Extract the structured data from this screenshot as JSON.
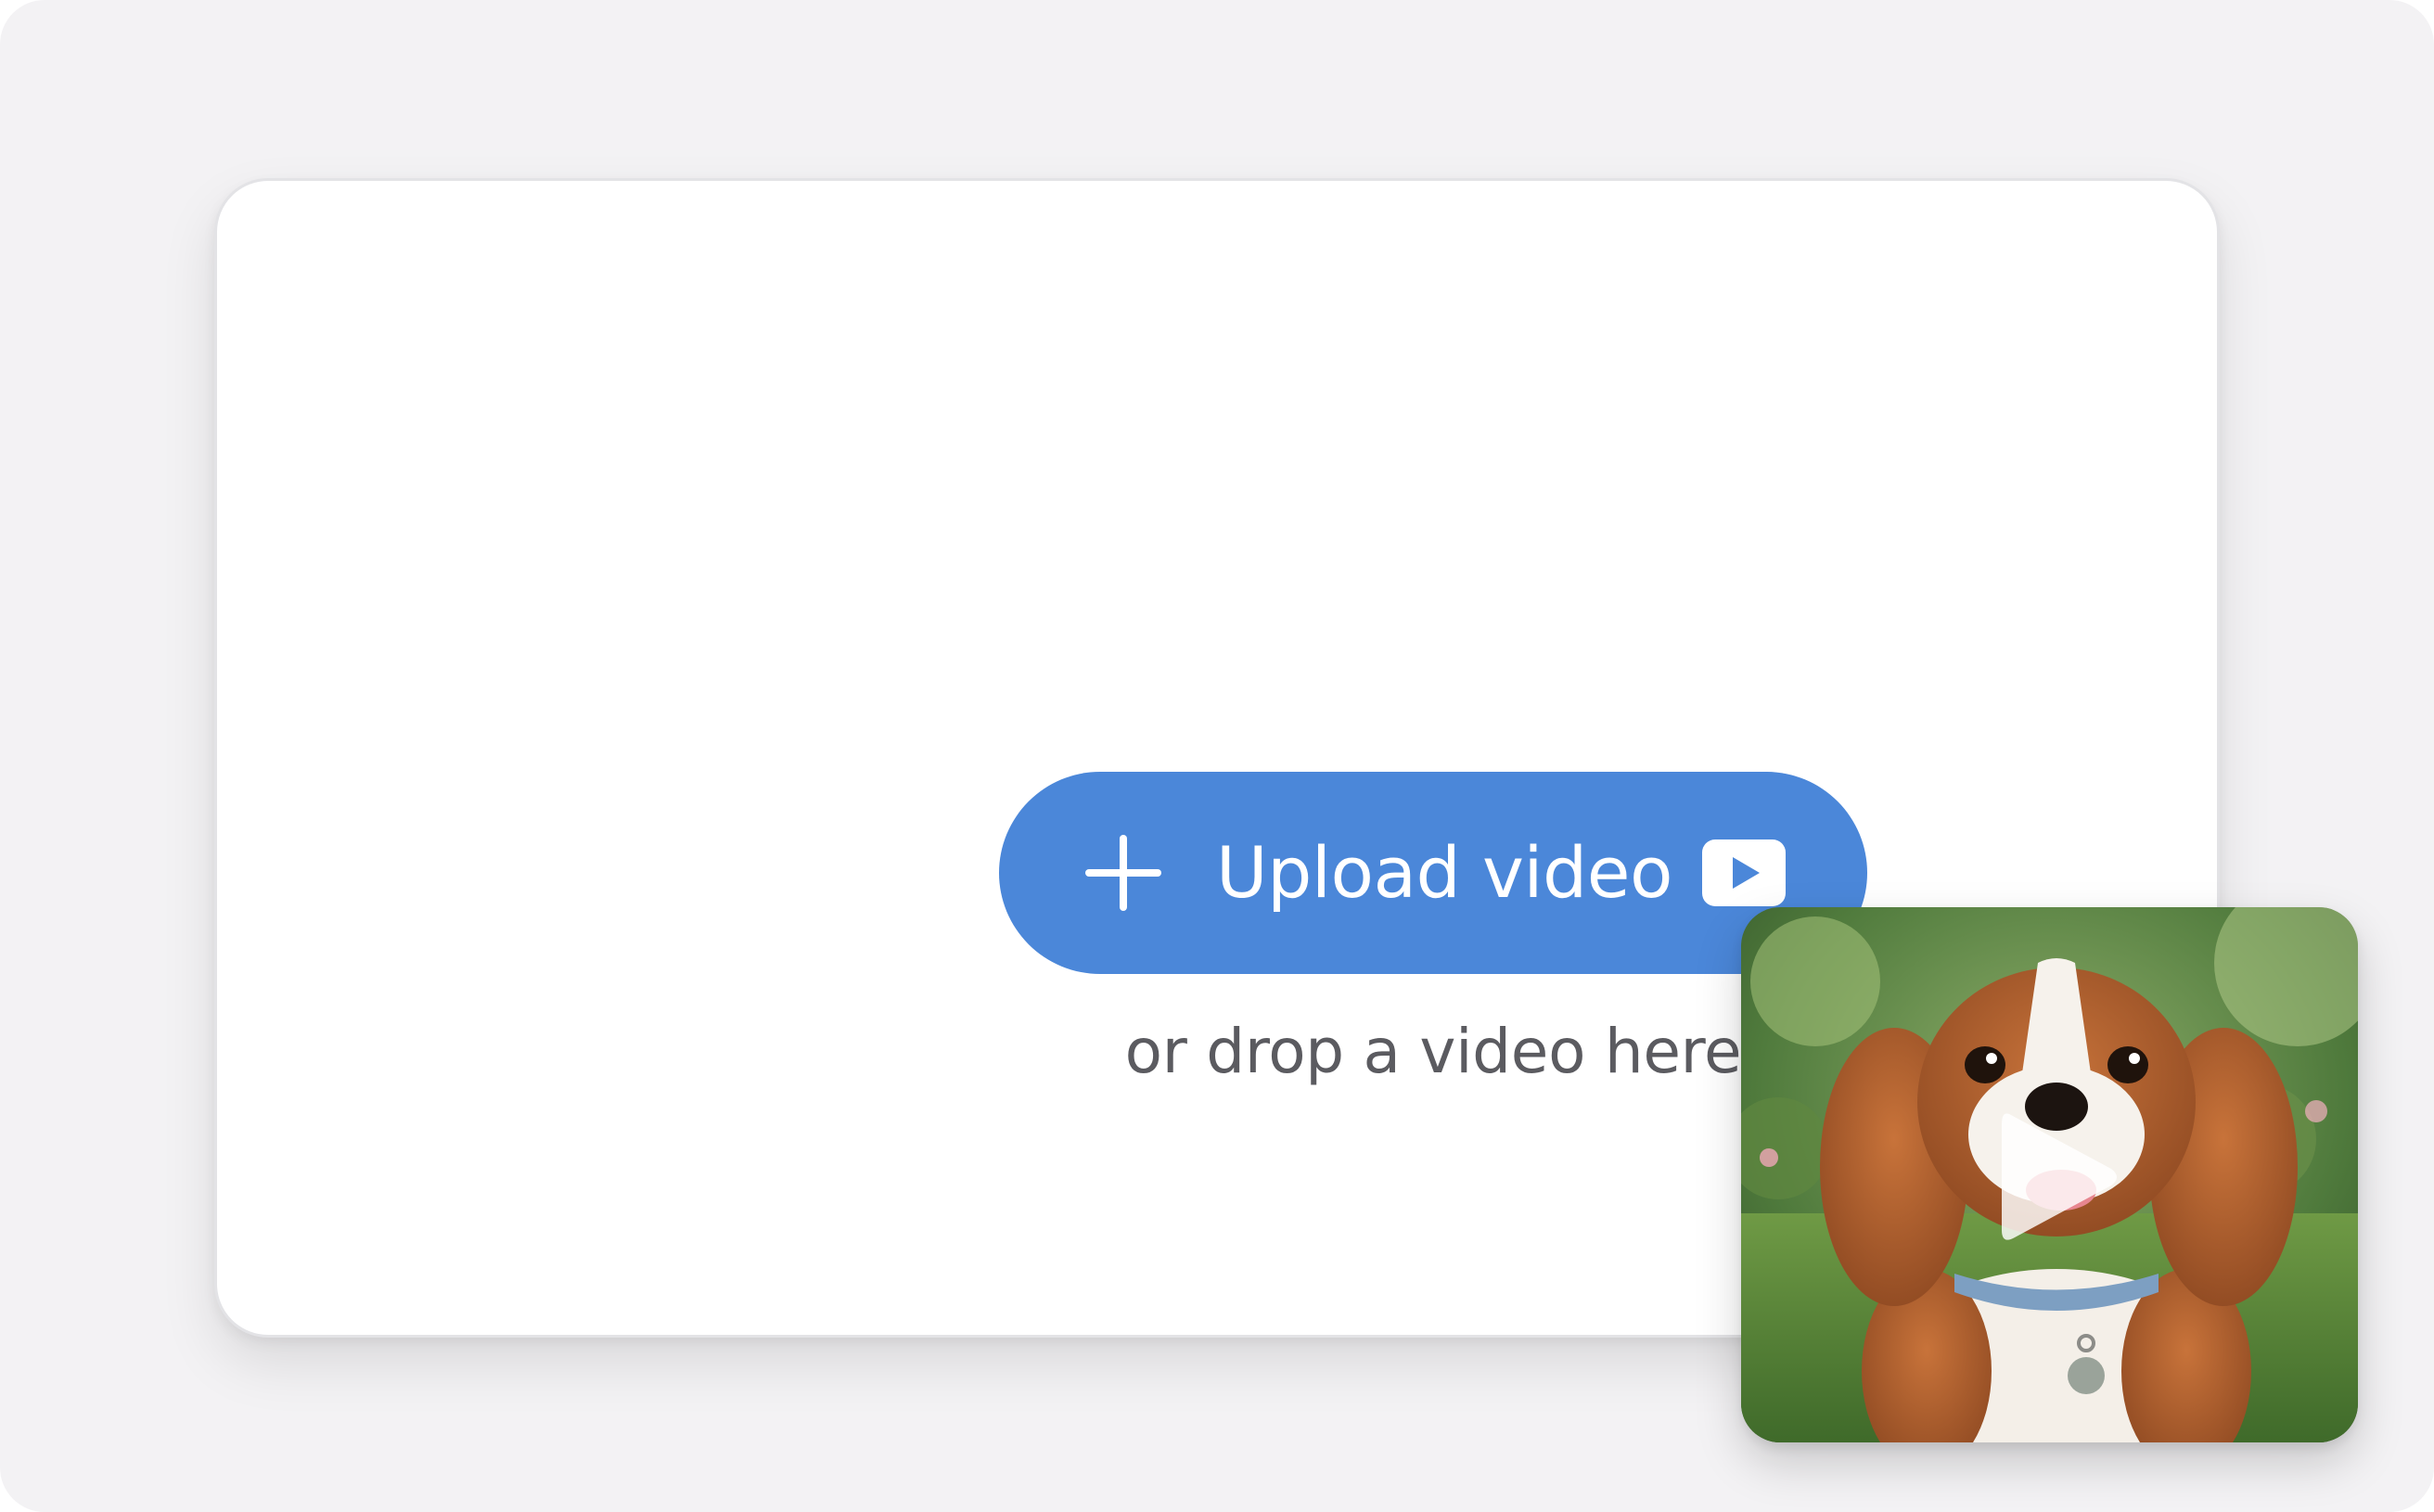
{
  "upload": {
    "button_label": "Upload video",
    "drop_hint": "or drop a video here",
    "plus_icon": "plus-icon",
    "video_icon": "video-play-icon"
  },
  "thumbnail": {
    "subject": "dog-video-thumbnail",
    "play_icon": "play-icon"
  },
  "colors": {
    "background": "#f3f2f4",
    "card": "#ffffff",
    "accent": "#4b87d9",
    "hint_text": "#5b5b60"
  }
}
